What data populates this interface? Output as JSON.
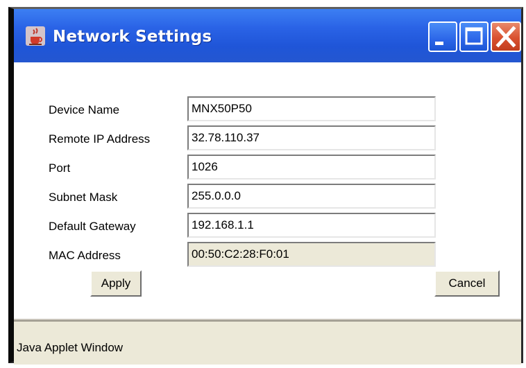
{
  "window": {
    "title": "Network Settings",
    "app_icon": "java-cup-icon",
    "controls": [
      "minimize-icon",
      "maximize-icon",
      "close-icon"
    ]
  },
  "form": {
    "fields": [
      {
        "label": "Device Name",
        "value": "MNX50P50",
        "readonly": false
      },
      {
        "label": "Remote IP Address",
        "value": "32.78.110.37",
        "readonly": false
      },
      {
        "label": "Port",
        "value": "1026",
        "readonly": false
      },
      {
        "label": "Subnet Mask",
        "value": "255.0.0.0",
        "readonly": false
      },
      {
        "label": "Default Gateway",
        "value": "192.168.1.1",
        "readonly": false
      },
      {
        "label": "MAC Address",
        "value": "00:50:C2:28:F0:01",
        "readonly": true
      }
    ],
    "apply_label": "Apply",
    "cancel_label": "Cancel"
  },
  "status": {
    "text": "Java Applet Window"
  },
  "colors": {
    "titlebar": "#2a63e6",
    "close_button": "#d9512f",
    "dialog_face": "#ece9d8"
  }
}
